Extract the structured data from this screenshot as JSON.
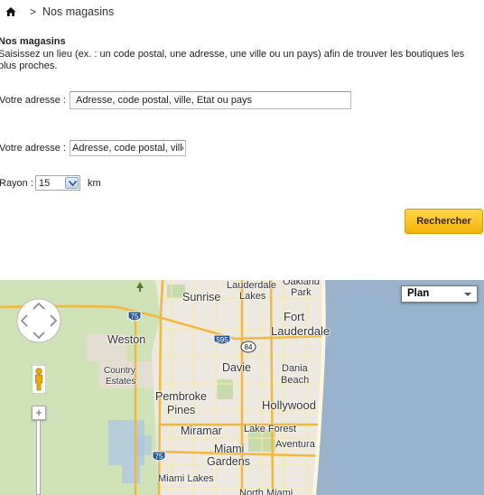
{
  "breadcrumb": {
    "home_icon": "home-icon",
    "separator": ">",
    "current": "Nos magasins"
  },
  "section": {
    "title": "Nos magasins",
    "description": "Saisissez un lieu (ex. : un code postal, une adresse, une ville ou un pays) afin de trouver les boutiques les plus proches."
  },
  "address_field_1": {
    "label": "Votre adresse :",
    "placeholder": "Adresse, code postal, ville, Etat ou pays"
  },
  "address_field_2": {
    "label": "Votre adresse :",
    "placeholder": "Adresse, code postal, ville, Etat ou pays"
  },
  "radius": {
    "label": "Rayon :",
    "selected": "15",
    "unit": "km"
  },
  "search_button": {
    "label": "Rechercher"
  },
  "map": {
    "map_type": "Plan",
    "zoom_in": "+",
    "places": {
      "sunrise": "Sunrise",
      "lauderdale_lakes_1": "Lauderdale",
      "lauderdale_lakes_2": "Lakes",
      "oakland_park_1": "Oakland",
      "oakland_park_2": "Park",
      "fort_lauderdale_1": "Fort",
      "fort_lauderdale_2": "Lauderdale",
      "weston": "Weston",
      "davie": "Davie",
      "dania_beach_1": "Dania",
      "dania_beach_2": "Beach",
      "country_estates_1": "Country",
      "country_estates_2": "Estates",
      "pembroke_pines_1": "Pembroke",
      "pembroke_pines_2": "Pines",
      "hollywood": "Hollywood",
      "miramar": "Miramar",
      "lake_forest": "Lake Forest",
      "aventura": "Aventura",
      "miami_gardens_1": "Miami",
      "miami_gardens_2": "Gardens",
      "miami_lakes": "Miami Lakes",
      "north_miami": "North Miami"
    },
    "shields": {
      "i75_north": "75",
      "i595": "595",
      "us84": "84",
      "i75_south": "75"
    }
  }
}
